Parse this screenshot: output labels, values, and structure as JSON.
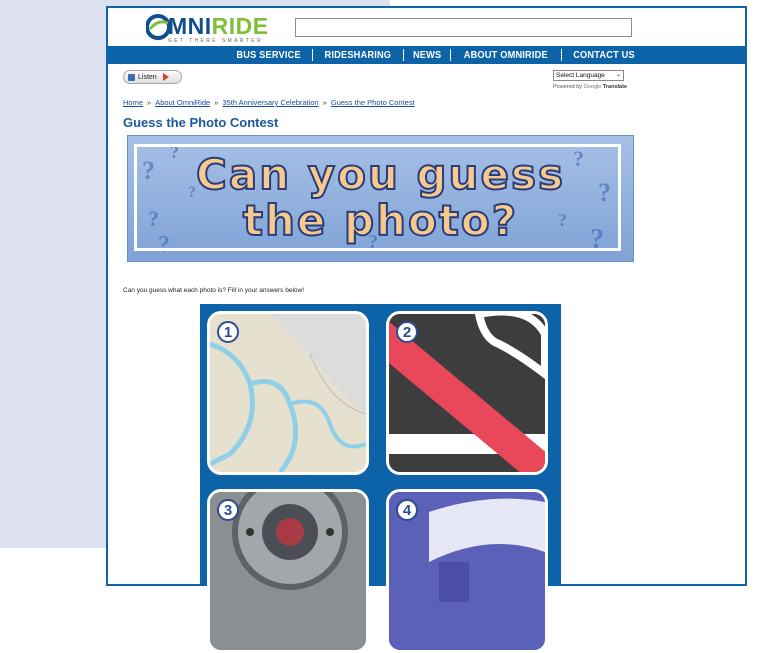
{
  "logo": {
    "word_omni": "MNI",
    "word_ride": "RIDE",
    "tagline": "GET THERE SMARTER"
  },
  "search": {
    "value": "",
    "placeholder": ""
  },
  "nav": {
    "items": [
      "BUS SERVICE",
      "RIDESHARING",
      "NEWS",
      "ABOUT OMNIRIDE",
      "CONTACT US"
    ]
  },
  "listen": {
    "label": "Listen"
  },
  "translate": {
    "selected": "Select Language",
    "powered_by": "Powered by",
    "google": "Google",
    "translate": "Translate"
  },
  "breadcrumb": {
    "items": [
      "Home",
      "About OmniRide",
      "35th Anniversary Celebration",
      "Guess the Photo Contest"
    ],
    "separator": "»"
  },
  "page": {
    "title": "Guess the Photo Contest",
    "banner_line1": "Can you guess",
    "banner_line2": "the photo?",
    "intro": "Can you guess what each photo is? Fill in your answers below!"
  },
  "photos": [
    {
      "number": "1",
      "icon": "map-photo"
    },
    {
      "number": "2",
      "icon": "no-symbol-photo"
    },
    {
      "number": "3",
      "icon": "mechanical-part-photo"
    },
    {
      "number": "4",
      "icon": "blue-sign-photo"
    }
  ],
  "colors": {
    "brand_blue": "#0d63a8",
    "brand_green": "#7fbf3b",
    "title_blue": "#1a5a9c",
    "banner_text": "#f6c98e"
  }
}
